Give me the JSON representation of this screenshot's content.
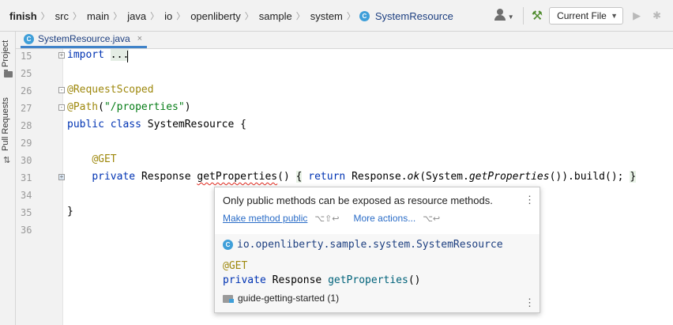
{
  "breadcrumbs": [
    "finish",
    "src",
    "main",
    "java",
    "io",
    "openliberty",
    "sample",
    "system",
    "SystemResource"
  ],
  "toolbar": {
    "run_config": "Current File",
    "icons": [
      "user-icon",
      "hammer-icon",
      "run-icon",
      "debug-icon"
    ]
  },
  "sidebar": {
    "tabs": [
      "Project",
      "Pull Requests"
    ]
  },
  "editor_tab": {
    "label": "SystemResource.java",
    "close": "×"
  },
  "editor": {
    "lines": [
      {
        "num": "15",
        "text": "import ..."
      },
      {
        "num": "25",
        "text": ""
      },
      {
        "num": "26",
        "text": "@RequestScoped"
      },
      {
        "num": "27",
        "text": "@Path(\"/properties\")"
      },
      {
        "num": "28",
        "text": "public class SystemResource {"
      },
      {
        "num": "29",
        "text": ""
      },
      {
        "num": "30",
        "text": "    @GET"
      },
      {
        "num": "31",
        "text": "    private Response getProperties() { return Response.ok(System.getProperties()).build(); }"
      },
      {
        "num": "34",
        "text": ""
      },
      {
        "num": "35",
        "text": "}"
      },
      {
        "num": "36",
        "text": ""
      }
    ],
    "tokens": {
      "import_kw": "import",
      "import_dots": "...",
      "ann_requestscoped": "@RequestScoped",
      "ann_path": "@Path",
      "paren_open": "(",
      "path_str": "\"/properties\"",
      "paren_close": ")",
      "public_kw": "public",
      "class_kw": "class",
      "class_name": "SystemResource {",
      "ann_get": "@GET",
      "private_kw": "private",
      "response_type": "Response",
      "method_name": "getProperties",
      "method_parens": "()",
      "brace_open": "{",
      "return_kw": "return",
      "response_ok_prefix": "Response.",
      "ok_call": "ok",
      "system_prefix": "(System.",
      "get_props_call": "getProperties",
      "build_suffix": "()).build();",
      "brace_close": "}",
      "class_close": "}"
    }
  },
  "popup": {
    "message": "Only public methods can be exposed as resource methods.",
    "fix_action": "Make method public",
    "fix_shortcut": "⌥⇧↩",
    "more_actions": "More actions...",
    "more_shortcut": "⌥↩",
    "class_fqn": "io.openliberty.sample.system.SystemResource",
    "sig_annotation": "@GET",
    "sig_private": "private",
    "sig_type": "Response",
    "sig_method": "getProperties",
    "sig_parens": "()",
    "module": "guide-getting-started (1)"
  },
  "colors": {
    "keyword": "#0033b3",
    "annotation": "#9e880d",
    "string": "#067d17",
    "link": "#2a6cc7",
    "error_underline": "#e0281d"
  }
}
